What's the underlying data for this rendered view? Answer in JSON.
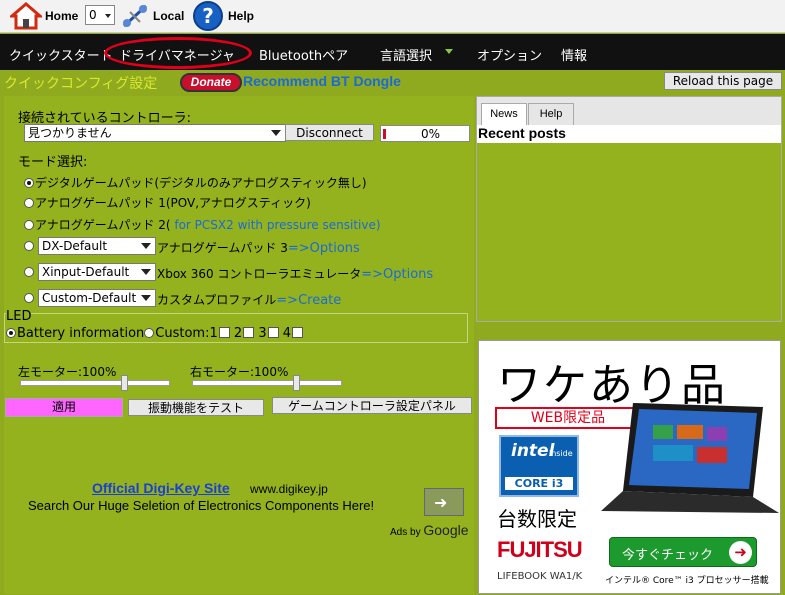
{
  "toolbar": {
    "home": "Home",
    "counter": "0",
    "local": "Local",
    "help": "Help"
  },
  "menu": {
    "items": [
      "クイックスタート",
      "ドライバマネージャ",
      "Bluetoothペア",
      "言語選択",
      "オプション",
      "情報"
    ]
  },
  "header": {
    "title": "クイックコンフィグ設定",
    "donate": "Donate",
    "recommend": "Recommend BT Dongle",
    "reload": "Reload this page"
  },
  "controller": {
    "label": "接続されているコントローラ:",
    "selected": "見つかりません",
    "disconnect": "Disconnect",
    "progress": "0%",
    "progress_value": 0
  },
  "modes": {
    "label": "モード選択:",
    "digital": "デジタルゲームパッド(デジタルのみアナログスティック無し)",
    "analog1": "アナログゲームパッド 1(POV,アナログスティック)",
    "analog2": "アナログゲームパッド 2(",
    "analog2_link": " for PCSX2 with pressure sensitive)",
    "dx_select": "DX-Default",
    "dx_text": "アナログゲームパッド 3",
    "dx_link": "=>Options",
    "xinput_select": "Xinput-Default",
    "xinput_text": "Xbox 360 コントローラエミュレータ",
    "xinput_link": "=>Options",
    "custom_select": "Custom-Default",
    "custom_text": "カスタムプロファイル",
    "custom_link": "=>Create"
  },
  "led": {
    "title": "LED",
    "battery": "Battery information",
    "custom": "Custom:",
    "n1": "1",
    "n2": "2",
    "n3": "3",
    "n4": "4"
  },
  "motors": {
    "left": "左モーター:100%",
    "right": "右モーター:100%",
    "left_value": 100,
    "right_value": 100,
    "apply": "適用",
    "test": "振動機能をテスト",
    "panel": "ゲームコントローラ設定パネル"
  },
  "google_ad": {
    "title": "Official Digi-Key Site",
    "url": "www.digikey.jp",
    "desc": "Search Our Huge Seletion of Electronics Components Here!",
    "ads_by": "Ads by",
    "google": "Google"
  },
  "news": {
    "tab_news": "News",
    "tab_help": "Help",
    "heading": "Recent posts"
  },
  "banner": {
    "headline": "ワケあり品",
    "web_only": "WEB限定品",
    "intel": "intel",
    "inside": "inside",
    "core": "CORE i3",
    "limited": "台数限定",
    "brand": "FUJITSU",
    "model": "LIFEBOOK WA1/K",
    "check": "今すぐチェック",
    "cpu_note": "インテル® Core™ i3 プロセッサー搭載"
  },
  "colors": {
    "accent_green": "#94b11e",
    "menu_bg": "#111111",
    "title_yellow": "#d8e830",
    "apply_pink": "#ff66ff",
    "highlight_red": "#e0001a"
  }
}
